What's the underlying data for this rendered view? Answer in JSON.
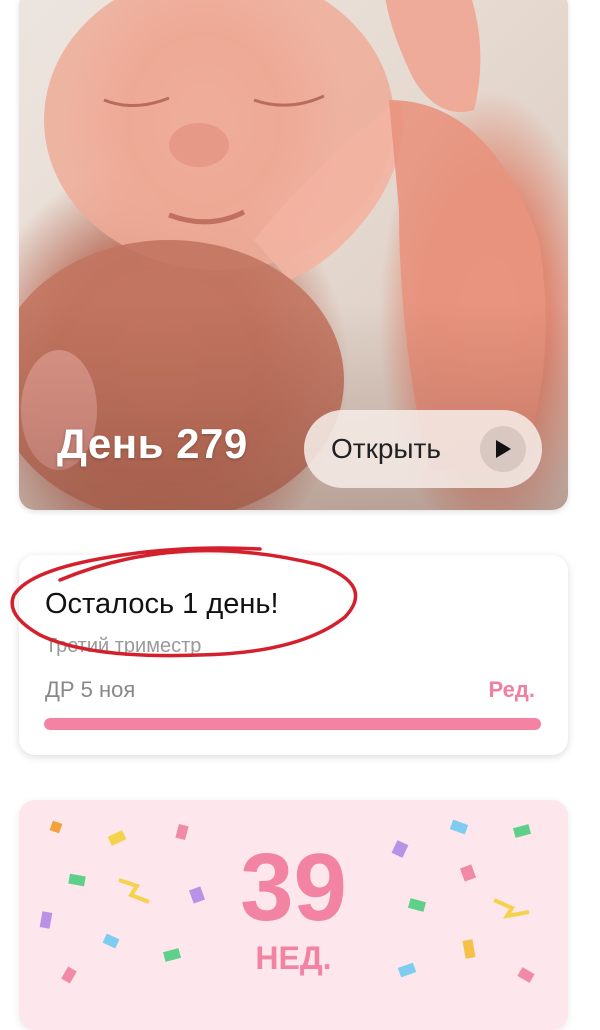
{
  "hero": {
    "day_label": "День 279",
    "open_label": "Открыть",
    "icon": "play-icon"
  },
  "countdown": {
    "remaining": "Осталось 1 день!",
    "trimester": "Третий триместр",
    "due_date": "ДР 5 ноя",
    "edit_label": "Ред.",
    "progress_fraction": 1.0,
    "accent_color": "#f483a3"
  },
  "week": {
    "number": "39",
    "unit": "НЕД."
  }
}
